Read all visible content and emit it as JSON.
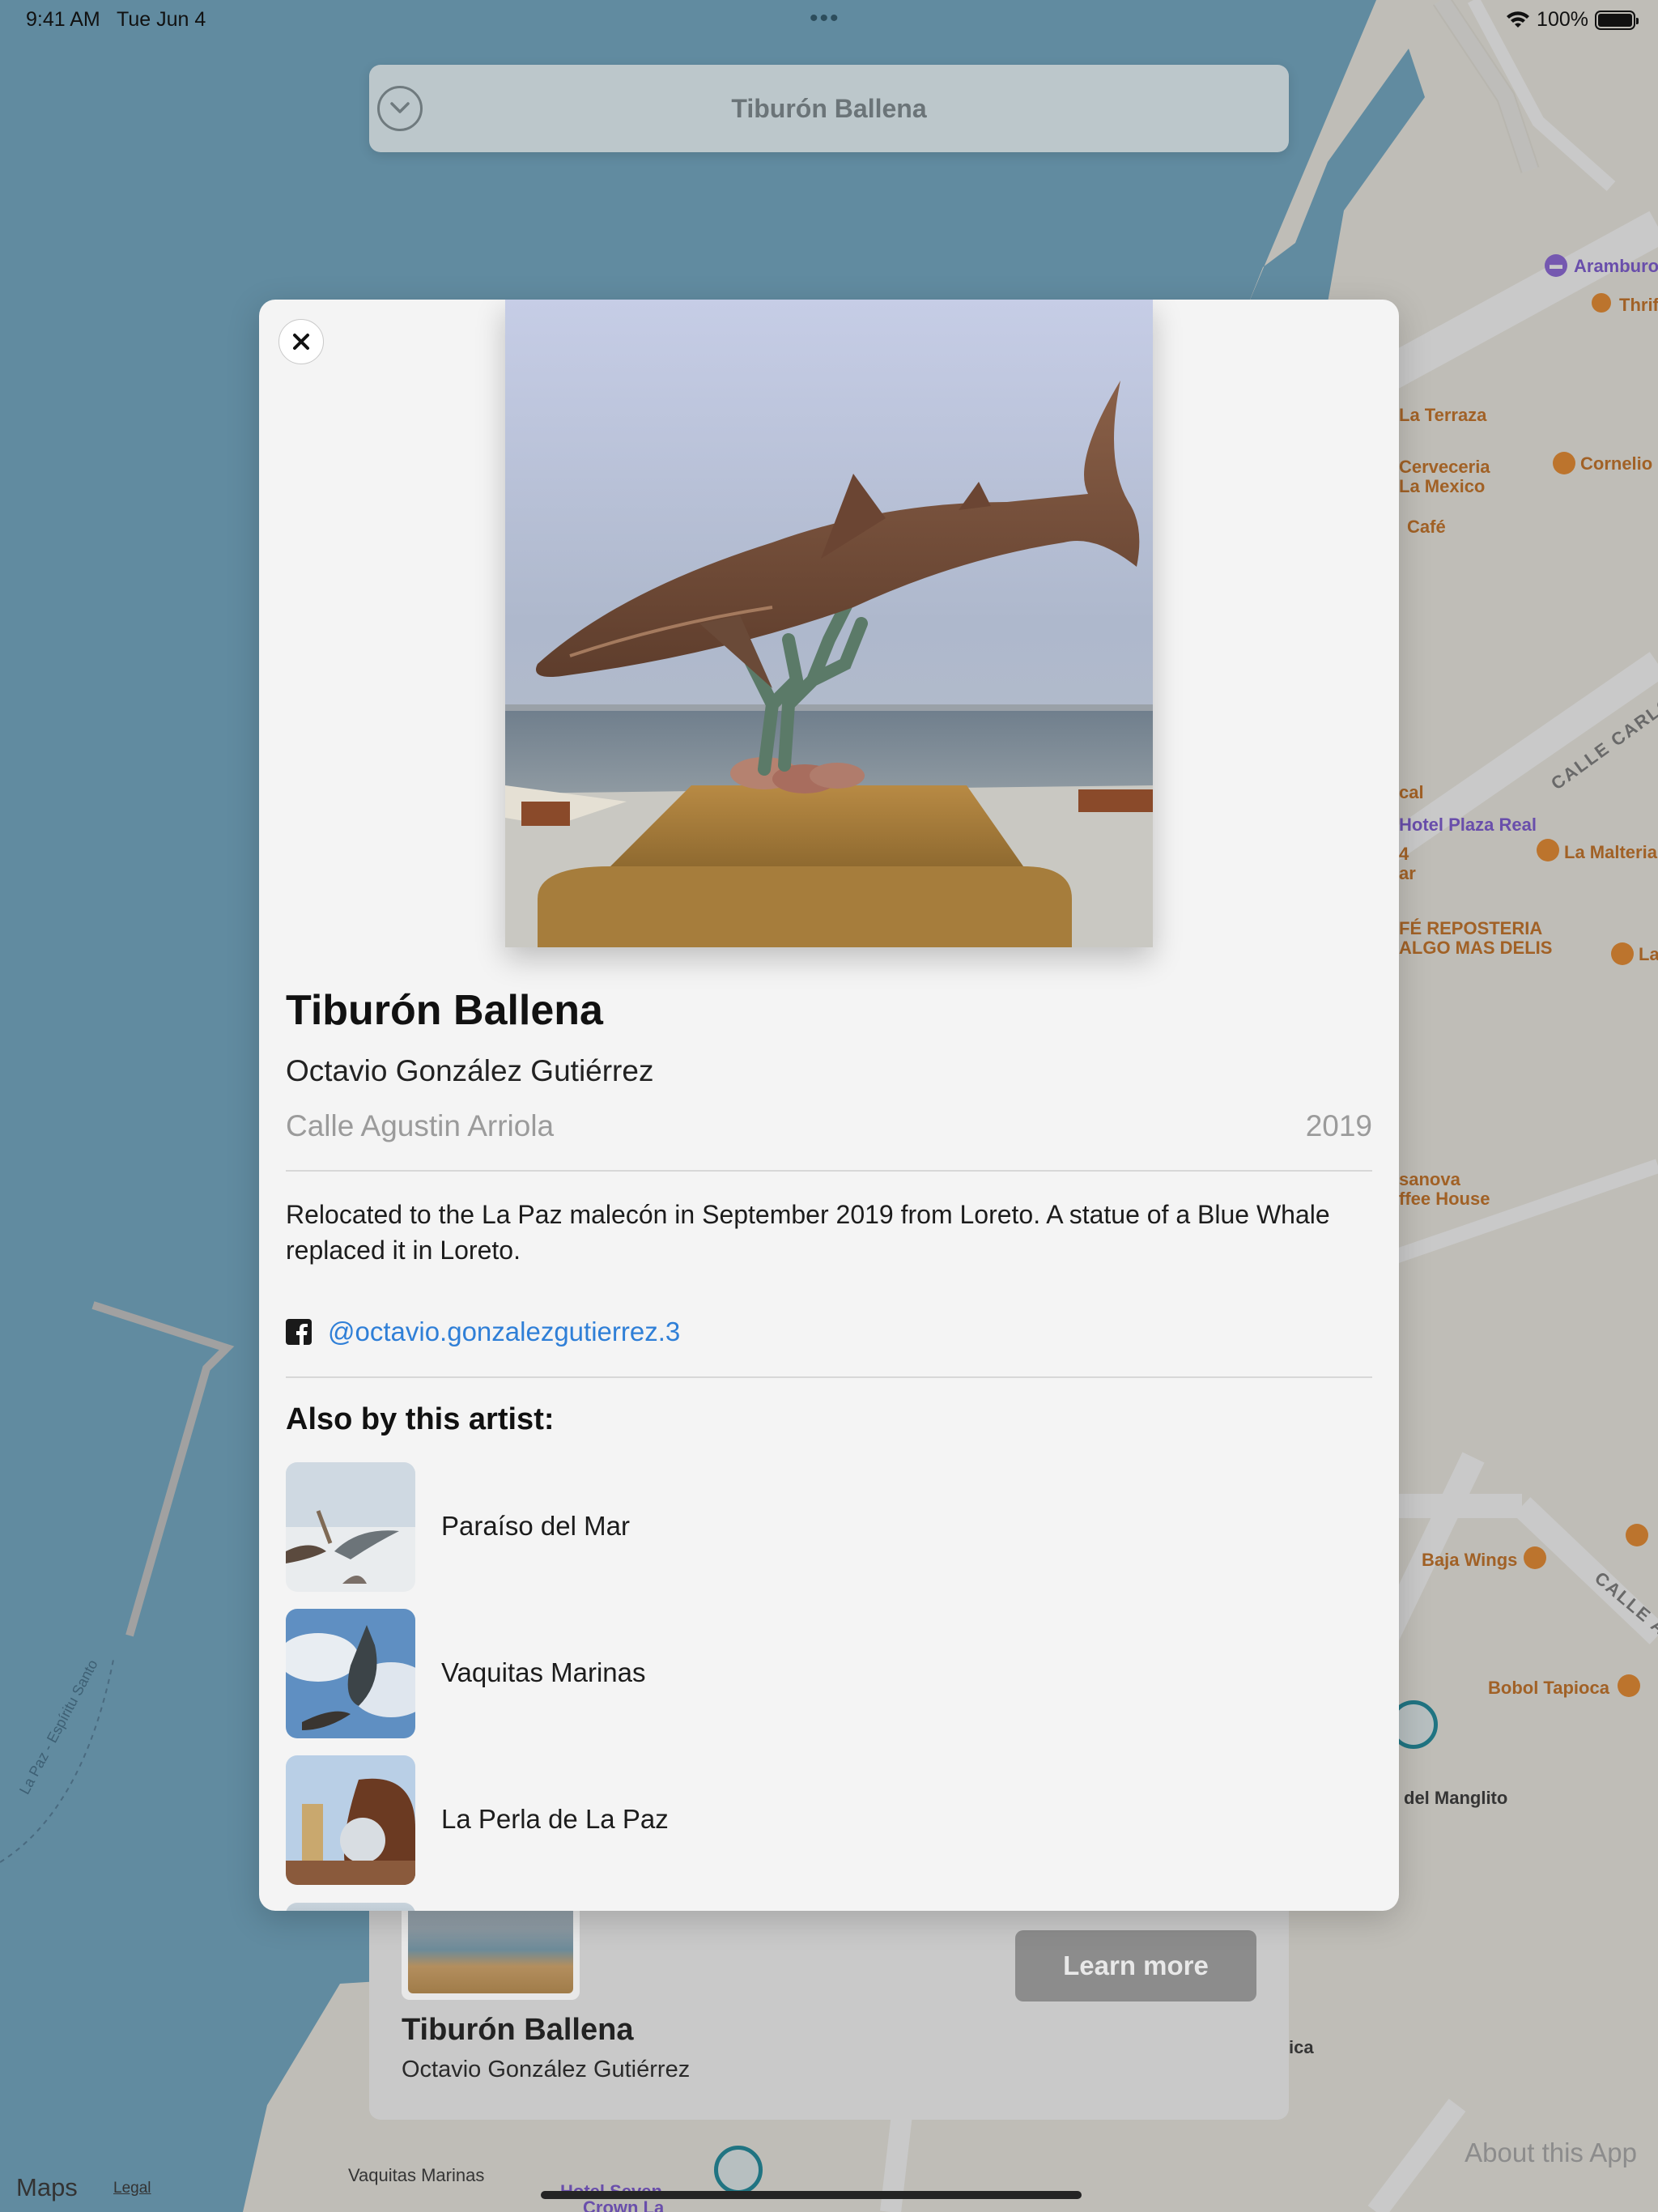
{
  "status_bar": {
    "time": "9:41 AM",
    "date": "Tue Jun 4",
    "battery": "100%"
  },
  "top_bar": {
    "title": "Tiburón Ballena"
  },
  "map": {
    "labels": {
      "aramburo": "Aramburo",
      "thrifty": "Thrif",
      "la_terraza": "La Terraza",
      "cerveceria_1": "Cerveceria",
      "cerveceria_2": "La Mexico",
      "cornelio": "Cornelio",
      "cafe": "Café",
      "calle_carlos": "CALLE CARLOS",
      "cal": "cal",
      "hotel_plaza_real": "Hotel Plaza Real",
      "bar_1": "4",
      "bar_2": "ar",
      "la_malteria": "La Malteria",
      "reposteria_1": "FÉ REPOSTERIA",
      "reposteria_2": "ALGO MAS DELIS",
      "la_right": "La",
      "casanova_1": "sanova",
      "casanova_2": "ffee House",
      "baja_wings": "Baja Wings",
      "calle_a": "CALLE A",
      "bobol_tapioca": "Bobol Tapioca",
      "del_manglito": "del Manglito",
      "ica": "ica",
      "la_paz_espiritu_santo": "La Paz - Espíritu Santo",
      "vaquitas_marinas": "Vaquitas Marinas",
      "hotel_seven_1": "Hotel Seven",
      "hotel_seven_2": "Crown La"
    }
  },
  "bottom_card": {
    "title": "Tiburón Ballena",
    "artist": "Octavio González Gutiérrez",
    "learn_more_label": "Learn more"
  },
  "modal": {
    "title": "Tiburón Ballena",
    "artist": "Octavio González Gutiérrez",
    "location": "Calle Agustin Arriola",
    "year": "2019",
    "description": "Relocated to the La Paz malecón in September 2019 from Loreto. A statue of a Blue Whale replaced it in Loreto.",
    "facebook_handle": "@octavio.gonzalezgutierrez.3",
    "also_heading": "Also by this artist:",
    "related": [
      {
        "label": "Paraíso del Mar"
      },
      {
        "label": "Vaquitas Marinas"
      },
      {
        "label": "La Perla de La Paz"
      }
    ]
  },
  "footer": {
    "maps_label": "Maps",
    "legal_label": "Legal",
    "about_label": "About this App"
  },
  "colors": {
    "water": "#6fa9c6",
    "land": "#f2efe6",
    "link_blue": "#2f7fd7",
    "poi_orange": "#c8701e",
    "poi_purple": "#7a55d6"
  }
}
